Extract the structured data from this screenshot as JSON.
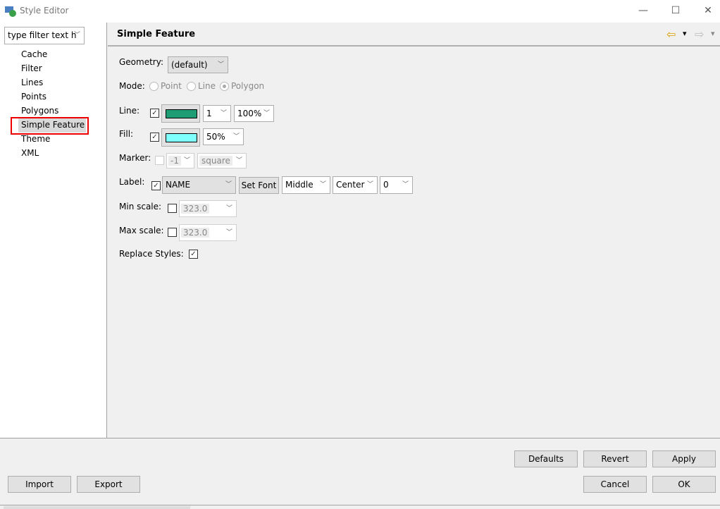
{
  "window": {
    "title": "Style Editor",
    "minimize": "—",
    "maximize": "☐",
    "close": "✕"
  },
  "sidebar": {
    "filter_placeholder": "type filter text h",
    "items": [
      {
        "label": "Cache"
      },
      {
        "label": "Filter"
      },
      {
        "label": "Lines"
      },
      {
        "label": "Points"
      },
      {
        "label": "Polygons"
      },
      {
        "label": "Simple Feature"
      },
      {
        "label": "Theme"
      },
      {
        "label": "XML"
      }
    ],
    "selected": "Simple Feature"
  },
  "header": {
    "title": "Simple Feature",
    "back": "⇦",
    "forward": "⇨",
    "dropdown": "▾"
  },
  "form": {
    "geometry": {
      "label": "Geometry:",
      "value": "(default)"
    },
    "mode": {
      "label": "Mode:",
      "options": [
        "Point",
        "Line",
        "Polygon"
      ],
      "selected": "Polygon"
    },
    "line": {
      "label": "Line:",
      "checked": true,
      "color": "#1e9c74",
      "width": "1",
      "opacity": "100%"
    },
    "fill": {
      "label": "Fill:",
      "checked": true,
      "color": "#80ffff",
      "opacity": "50%"
    },
    "marker": {
      "label": "Marker:",
      "checked": false,
      "size": "-1",
      "shape": "square"
    },
    "label": {
      "label": "Label:",
      "checked": true,
      "field": "NAME",
      "set_font": "Set Font",
      "vertical": "Middle",
      "horizontal": "Center",
      "rotation": "0"
    },
    "min_scale": {
      "label": "Min scale:",
      "checked": false,
      "value": "323.0"
    },
    "max_scale": {
      "label": "Max scale:",
      "checked": false,
      "value": "323.0"
    },
    "replace_styles": {
      "label": "Replace Styles:",
      "checked": true
    }
  },
  "buttons": {
    "defaults": "Defaults",
    "revert": "Revert",
    "apply": "Apply",
    "import": "Import",
    "export": "Export",
    "cancel": "Cancel",
    "ok": "OK"
  },
  "glyphs": {
    "check": "✓",
    "chevron": "﹀"
  }
}
